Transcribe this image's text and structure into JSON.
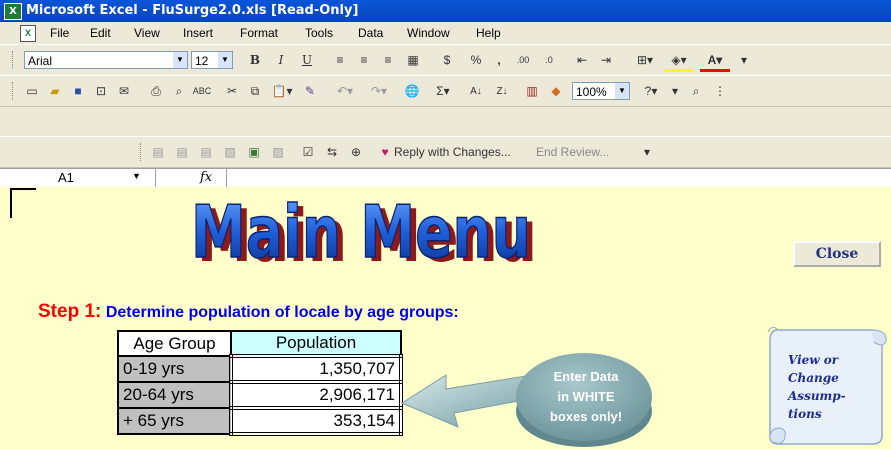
{
  "window": {
    "title": "Microsoft Excel - FluSurge2.0.xls [Read-Only]",
    "app_icon": "excel-icon"
  },
  "menu": [
    "File",
    "Edit",
    "View",
    "Insert",
    "Format",
    "Tools",
    "Data",
    "Window",
    "Help"
  ],
  "format_toolbar": {
    "font": "Arial",
    "size": "12"
  },
  "standard_toolbar": {
    "zoom": "100%"
  },
  "review_toolbar": {
    "reply_label": "Reply with Changes...",
    "end_review_label": "End Review..."
  },
  "formula_bar": {
    "name_box": "A1",
    "fx": "fx",
    "value": ""
  },
  "sheet": {
    "main_title": "Main Menu",
    "close_label": "Close",
    "step_number": "Step 1:",
    "step_text": "Determine population of locale by age groups:",
    "table": {
      "headers": [
        "Age Group",
        "Population"
      ],
      "rows": [
        {
          "age": "0-19 yrs",
          "pop": "1,350,707"
        },
        {
          "age": "20-64 yrs",
          "pop": "2,906,171"
        },
        {
          "age": "+ 65 yrs",
          "pop": "353,154"
        }
      ]
    },
    "callout": [
      "Enter Data",
      "in WHITE",
      "boxes only!"
    ],
    "scroll_button": [
      "View or",
      "Change",
      "Assump-",
      "tions"
    ],
    "colors": {
      "background": "#ffffcc",
      "title_blue": "#1e56c8",
      "step_red": "#ff0000",
      "step_blue": "#0000ee"
    }
  }
}
